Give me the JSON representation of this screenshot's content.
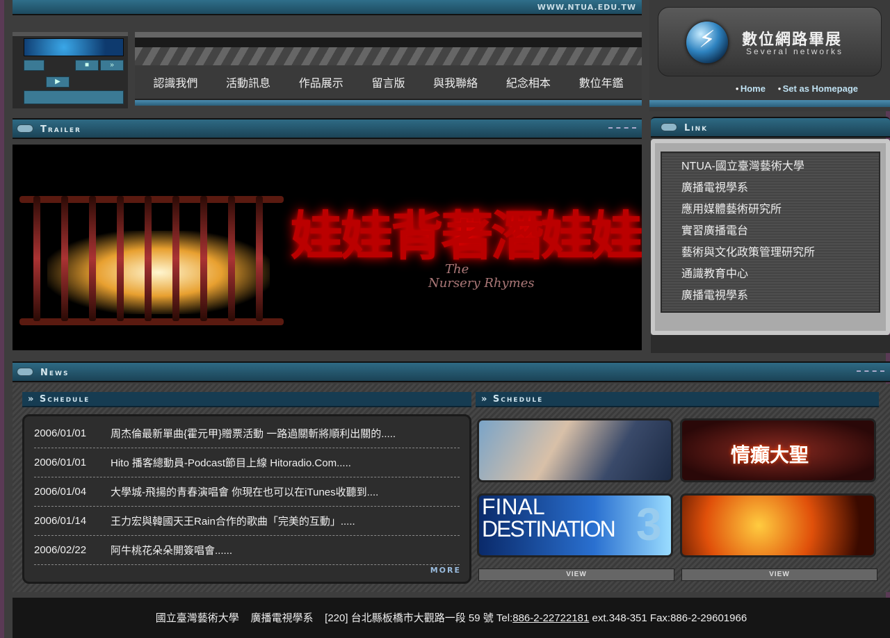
{
  "header": {
    "url": "WWW.NTUA.EDU.TW",
    "nav": [
      "認識我們",
      "活動訊息",
      "作品展示",
      "留言版",
      "與我聯絡",
      "紀念相本",
      "數位年鑑"
    ]
  },
  "player": {
    "stop": "■",
    "forward": "»",
    "play": "▶"
  },
  "brand": {
    "title": "數位網路畢展",
    "subtitle": "Several networks",
    "logo_symbol": "⚡",
    "links": {
      "home": "Home",
      "set_home": "Set as Homepage"
    }
  },
  "trailer": {
    "section_title": "Trailer",
    "poster_title": "娃娃背著潛娃娃",
    "poster_subtitle_1": "The",
    "poster_subtitle_2": "Nursery Rhymes"
  },
  "link": {
    "section_title": "Link",
    "items": [
      "NTUA-國立臺灣藝術大學",
      "廣播電視學系",
      "應用媒體藝術研究所",
      "實習廣播電台",
      "藝術與文化政策管理研究所",
      "通識教育中心",
      "廣播電視學系"
    ]
  },
  "news": {
    "section_title": "News",
    "schedule_left": "» Schedule",
    "schedule_right": "» Schedule",
    "items": [
      {
        "date": "2006/01/01",
        "text": "周杰倫最新單曲{霍元甲}贈票活動 一路過關斬將順利出關的....."
      },
      {
        "date": "2006/01/01",
        "text": "Hito 播客總動員-Podcast節目上線 Hitoradio.Com....."
      },
      {
        "date": "2006/01/04",
        "text": "大學城-飛揚的青春演唱會 你現在也可以在iTunes收聽到...."
      },
      {
        "date": "2006/01/14",
        "text": "王力宏與韓國天王Rain合作的歌曲「完美的互動」....."
      },
      {
        "date": "2006/02/22",
        "text": "阿牛桃花朵朵開簽唱會......"
      }
    ],
    "more": "MORE",
    "thumbs": {
      "t2_title": "情癲大聖",
      "t3_line1": "FINAL",
      "t3_line2": "DESTINATION",
      "t3_num": "3"
    },
    "view": "VIEW"
  },
  "footer": {
    "school": "國立臺灣藝術大學",
    "dept": "廣播電視學系",
    "address": "[220] 台北縣板橋市大觀路一段 59 號 Tel:",
    "tel": "886-2-22722181",
    "ext": " ext.348-351 Fax:886-2-29601966"
  }
}
